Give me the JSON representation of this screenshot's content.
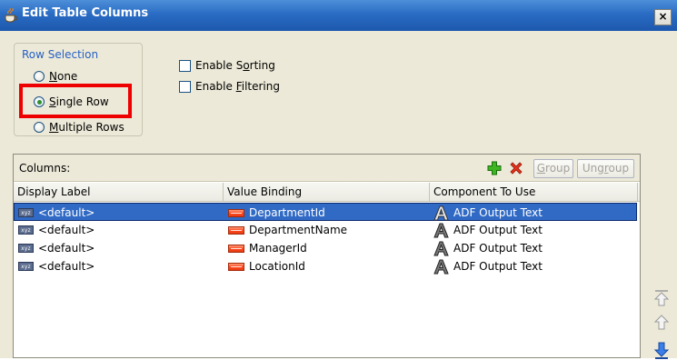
{
  "window": {
    "title": "Edit Table Columns",
    "close_label": "×"
  },
  "row_selection": {
    "legend": "Row Selection",
    "options": [
      {
        "pre": "",
        "mnemonic": "N",
        "post": "one",
        "checked": false
      },
      {
        "pre": "",
        "mnemonic": "S",
        "post": "ingle Row",
        "checked": true
      },
      {
        "pre": "",
        "mnemonic": "M",
        "post": "ultiple Rows",
        "checked": false
      }
    ]
  },
  "checkboxes": [
    {
      "pre": "Enable S",
      "mnemonic": "o",
      "post": "rting",
      "checked": false
    },
    {
      "pre": "Enable ",
      "mnemonic": "F",
      "post": "iltering",
      "checked": false
    }
  ],
  "columns": {
    "label": "Columns:",
    "group_button": {
      "mnemonic": "G",
      "post": "roup"
    },
    "ungroup_button": {
      "pre": "Ung",
      "mnemonic": "r",
      "post": "oup"
    },
    "headers": [
      "Display Label",
      "Value Binding",
      "Component To Use"
    ],
    "rows": [
      {
        "display_label": "<default>",
        "value_binding": "DepartmentId",
        "component": "ADF Output Text",
        "selected": true
      },
      {
        "display_label": "<default>",
        "value_binding": "DepartmentName",
        "component": "ADF Output Text",
        "selected": false
      },
      {
        "display_label": "<default>",
        "value_binding": "ManagerId",
        "component": "ADF Output Text",
        "selected": false
      },
      {
        "display_label": "<default>",
        "value_binding": "LocationId",
        "component": "ADF Output Text",
        "selected": false
      }
    ]
  },
  "icons": {
    "title": "coffee-cup-icon",
    "add": "green-plus-icon",
    "delete": "red-x-icon",
    "display_label": "xyz-icon",
    "value_binding": "attribute-icon",
    "component": "output-text-a-icon",
    "move_top": "move-top-icon",
    "move_up": "move-up-icon",
    "move_down": "move-down-icon"
  },
  "colors": {
    "titlebar": "#2a6cc4",
    "selection": "#316ac5",
    "highlight_box": "#ee0000",
    "legend": "#2660c6"
  }
}
